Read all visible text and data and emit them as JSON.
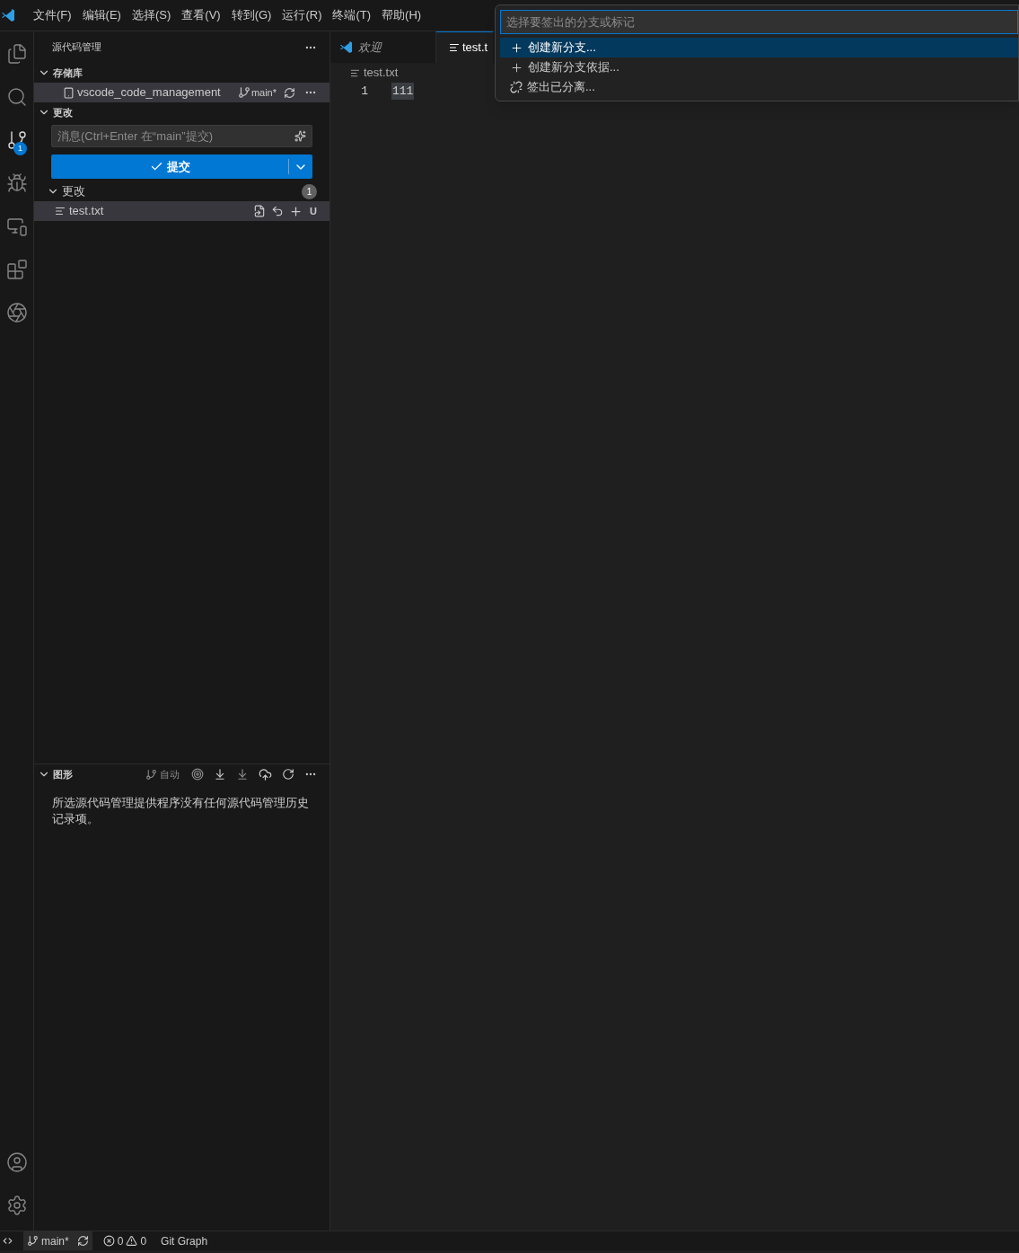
{
  "menu": [
    "文件(F)",
    "编辑(E)",
    "选择(S)",
    "查看(V)",
    "转到(G)",
    "运行(R)",
    "终端(T)",
    "帮助(H)"
  ],
  "activity_bar": {
    "items": [
      {
        "kind": "files",
        "selected": false
      },
      {
        "kind": "search",
        "selected": false
      },
      {
        "kind": "scm",
        "selected": true,
        "badge": "1"
      },
      {
        "kind": "debug",
        "selected": false
      },
      {
        "kind": "remote",
        "selected": false
      },
      {
        "kind": "extensions",
        "selected": false
      },
      {
        "kind": "chat",
        "selected": false
      }
    ],
    "bottom": [
      {
        "kind": "account"
      },
      {
        "kind": "settings"
      }
    ]
  },
  "sidebar": {
    "title": "源代码管理",
    "repositories": {
      "title": "存储库",
      "repo": {
        "name": "vscode_code_management",
        "branch": "main*"
      }
    },
    "changes": {
      "title": "更改",
      "message_placeholder": "消息(Ctrl+Enter 在“main”提交)",
      "commit_label": "提交",
      "group": {
        "title": "更改",
        "count": "1",
        "files": [
          {
            "name": "test.txt",
            "status": "U"
          }
        ]
      }
    },
    "graph": {
      "title": "图形",
      "auto_label": "自动",
      "message": "所选源代码管理提供程序没有任何源代码管理历史记录项。"
    }
  },
  "editor": {
    "tabs": [
      {
        "label": "欢迎",
        "kind": "welcome",
        "selected": false
      },
      {
        "label": "test.t",
        "kind": "text",
        "selected": true
      }
    ],
    "breadcrumb": "test.txt",
    "lines": [
      {
        "number": "1",
        "text": "111"
      }
    ]
  },
  "quick_pick": {
    "placeholder": "选择要签出的分支或标记",
    "items": [
      {
        "label": "创建新分支...",
        "kind": "add",
        "selected": true
      },
      {
        "label": "创建新分支依据...",
        "kind": "add",
        "selected": false
      },
      {
        "label": "签出已分离...",
        "kind": "detach",
        "selected": false
      }
    ]
  },
  "status_bar": {
    "branch": "main*",
    "errors": "0",
    "warnings": "0",
    "extension": "Git Graph"
  }
}
